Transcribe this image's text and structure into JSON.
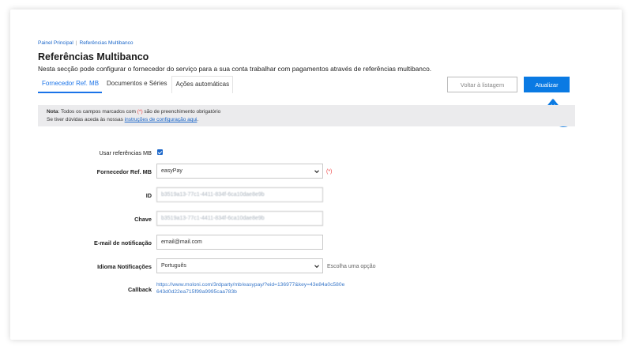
{
  "breadcrumb": {
    "home": "Painel Principal",
    "sep": "|",
    "current": "Referências Multibanco"
  },
  "page": {
    "title": "Referências Multibanco",
    "description": "Nesta secção pode configurar o fornecedor do serviço para a sua conta trabalhar com pagamentos através de referências multibanco."
  },
  "tabs": [
    {
      "label": "Fornecedor Ref. MB",
      "active": true
    },
    {
      "label": "Documentos e Séries",
      "active": false
    },
    {
      "label": "Ações automáticas",
      "active": false
    }
  ],
  "buttons": {
    "back": "Voltar à listagem",
    "update": "Atualizar"
  },
  "notice": {
    "bold": "Nota",
    "line1_a": ": Todos os campos marcados com ",
    "req": "(*)",
    "line1_b": " são de preenchimento obrigatório",
    "line2_a": "Se tiver dúvidas aceda às nossas ",
    "link": "instruções de configuração aqui",
    "line2_b": "."
  },
  "form": {
    "use_mb": {
      "label": "Usar referências MB",
      "checked": true
    },
    "provider": {
      "label": "Fornecedor Ref. MB",
      "value": "easyPay",
      "required": "(*)"
    },
    "id": {
      "label": "ID",
      "value": "b3519a13-77c1-4411-834f-6ca10dae8e9b"
    },
    "key": {
      "label": "Chave",
      "value": "b3519a13-77c1-4411-834f-6ca10dae8e9b"
    },
    "email": {
      "label": "E-mail de notificação",
      "value": "email@mail.com"
    },
    "language": {
      "label": "Idioma Notificações",
      "value": "Português",
      "hint": "Escolha uma opção"
    },
    "callback": {
      "label": "Callback",
      "value": "https://www.moloni.com/3rdparty/mb/easypay/?eid=136977&key=43e84a0c580e643d0d22ea715f99a9995caa783b"
    }
  },
  "colors": {
    "accent": "#0a7ae3",
    "link": "#1a66c9",
    "required": "#e44444"
  },
  "icons": {
    "select": "chevron-down-icon",
    "annotation": "curved-arrow-icon"
  }
}
